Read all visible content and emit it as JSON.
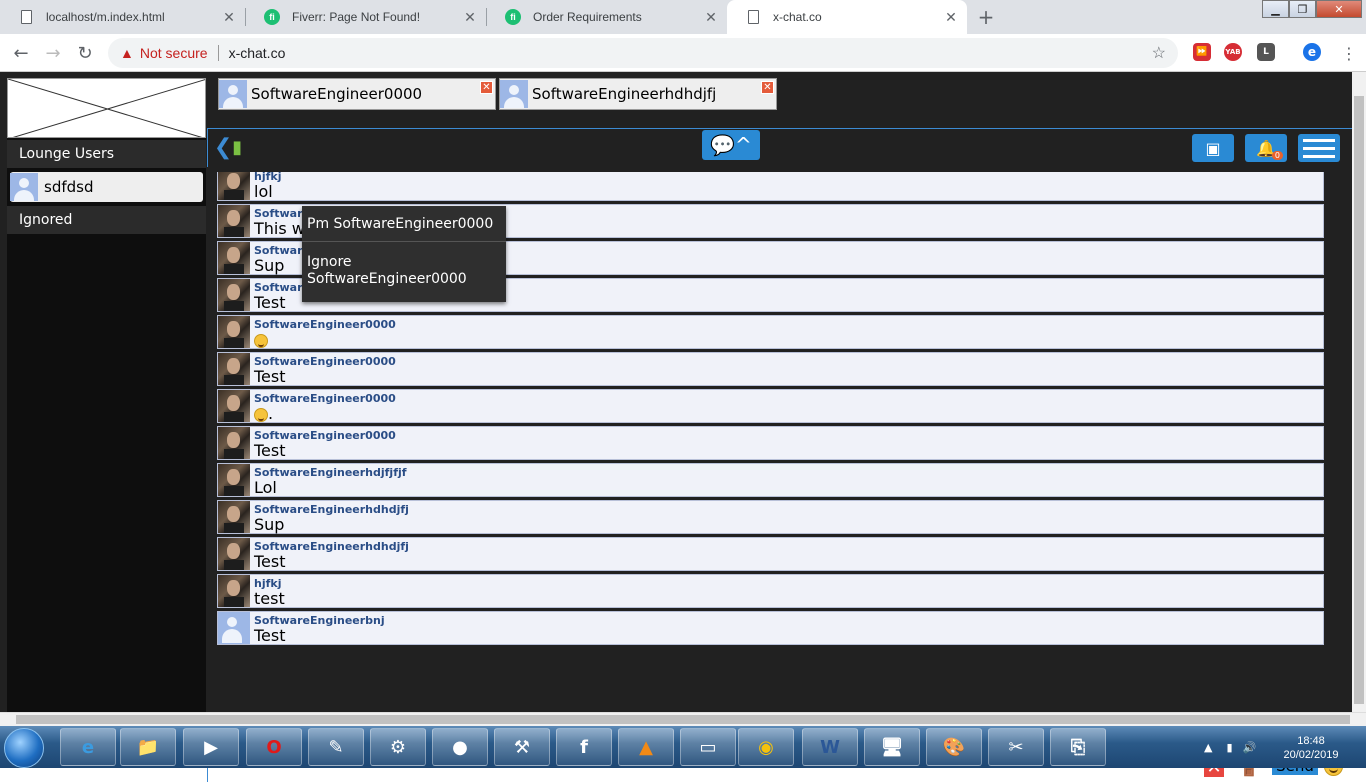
{
  "browser": {
    "tabs": [
      {
        "title": "localhost/m.index.html",
        "icon": "page-icon"
      },
      {
        "title": "Fiverr: Page Not Found!",
        "icon": "fiverr-icon"
      },
      {
        "title": "Order Requirements",
        "icon": "fiverr-icon"
      },
      {
        "title": "x-chat.co",
        "icon": "page-icon",
        "active": true
      }
    ],
    "new_tab_label": "+",
    "not_secure": "Not secure",
    "url": "x-chat.co",
    "extensions": [
      "YAB",
      "L"
    ],
    "profile_initial": "e"
  },
  "sidebar": {
    "lounge_label": "Lounge Users",
    "users": [
      "sdfdsd"
    ],
    "ignored_label": "Ignored"
  },
  "pm_tabs": [
    {
      "label": "SoftwareEngineer0000"
    },
    {
      "label": "SoftwareEngineerhdhdjfj"
    }
  ],
  "notifications_count": "0",
  "messages": [
    {
      "name": "hjfkj",
      "text": "lol",
      "avatar": "photo"
    },
    {
      "name": "SoftwareEngineer0000",
      "text": "This w",
      "avatar": "photo"
    },
    {
      "name": "SoftwareEngineer0000",
      "text": "Sup",
      "avatar": "photo"
    },
    {
      "name": "SoftwareEngineer0000",
      "text": "Test",
      "avatar": "photo"
    },
    {
      "name": "SoftwareEngineer0000",
      "text": "",
      "emoji": true,
      "avatar": "photo"
    },
    {
      "name": "SoftwareEngineer0000",
      "text": "Test",
      "avatar": "photo"
    },
    {
      "name": "SoftwareEngineer0000",
      "text": ".",
      "emoji": true,
      "avatar": "photo"
    },
    {
      "name": "SoftwareEngineer0000",
      "text": "Test",
      "avatar": "photo"
    },
    {
      "name": "SoftwareEngineerhdjfjfjf",
      "text": "Lol",
      "avatar": "photo"
    },
    {
      "name": "SoftwareEngineerhdhdjfj",
      "text": "Sup",
      "avatar": "photo"
    },
    {
      "name": "SoftwareEngineerhdhdjfj",
      "text": "Test",
      "avatar": "photo"
    },
    {
      "name": "hjfkj",
      "text": "test",
      "avatar": "photo"
    },
    {
      "name": "SoftwareEngineerbnj",
      "text": "Test",
      "avatar": "default"
    }
  ],
  "context_menu": {
    "pm": "Pm SoftwareEngineer0000",
    "ignore": "Ignore SoftwareEngineer0000"
  },
  "composer": {
    "input_value": "",
    "send_label": "Send"
  },
  "taskbar": {
    "time": "18:48",
    "date": "20/02/2019"
  }
}
